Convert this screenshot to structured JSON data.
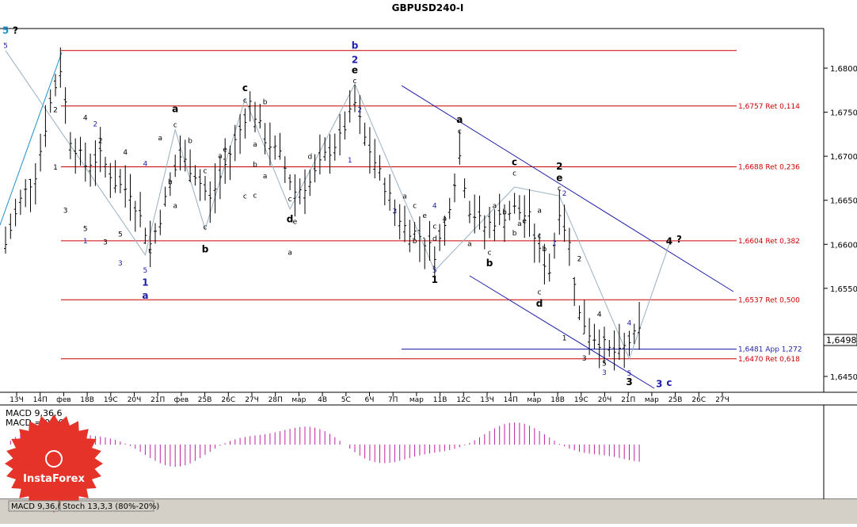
{
  "chart_data": {
    "type": "ohlc",
    "title": "GBPUSD240-I",
    "price_tag": "1,6498",
    "y_ticks": [
      "1,6800",
      "1,6750",
      "1,6700",
      "1,6650",
      "1,6600",
      "1,6550",
      "1,6450"
    ],
    "ylim": [
      1.6432,
      1.6845
    ],
    "x_ticks": [
      "13Ч",
      "14П",
      "фев",
      "18В",
      "19С",
      "20Ч",
      "21П",
      "фев",
      "25В",
      "26С",
      "27Ч",
      "28П",
      "мар",
      "4В",
      "5С",
      "6Ч",
      "7П",
      "мар",
      "11В",
      "12С",
      "13Ч",
      "14П",
      "мар",
      "18В",
      "19С",
      "20Ч",
      "21П",
      "мар",
      "25В",
      "26С",
      "27Ч"
    ],
    "levels": [
      {
        "price": 1.682,
        "label": ""
      },
      {
        "price": 1.6757,
        "label": "1,6757 Ret 0,114"
      },
      {
        "price": 1.6688,
        "label": "1,6688 Ret 0,236"
      },
      {
        "price": 1.6604,
        "label": "1,6604 Ret 0,382"
      },
      {
        "price": 1.6537,
        "label": "1,6537 Ret 0,500"
      },
      {
        "price": 1.6481,
        "label": "1,6481 App 1,272"
      },
      {
        "price": 1.647,
        "label": "1,6470 Ret 0,618"
      }
    ],
    "wave_labels": [
      {
        "t": "5",
        "bar": 0,
        "p": 1.6839,
        "c": "teal",
        "big": true
      },
      {
        "t": "?",
        "bar": 2,
        "p": 1.6839,
        "c": "black",
        "big": true
      },
      {
        "t": "5",
        "bar": 0,
        "p": 1.6823,
        "c": "blue"
      },
      {
        "t": "b",
        "bar": 70,
        "p": 1.6822,
        "c": "blue",
        "big": true
      },
      {
        "t": "2",
        "bar": 70,
        "p": 1.6806,
        "c": "blue",
        "big": true
      },
      {
        "t": "e",
        "bar": 70,
        "p": 1.6794,
        "c": "black",
        "big": true
      },
      {
        "t": "c",
        "bar": 70,
        "p": 1.6783,
        "c": "black"
      },
      {
        "t": "2",
        "bar": 71,
        "p": 1.675,
        "c": "blue"
      },
      {
        "t": "1",
        "bar": 69,
        "p": 1.6693,
        "c": "blue"
      },
      {
        "t": "c",
        "bar": 48,
        "p": 1.6774,
        "c": "black",
        "big": true
      },
      {
        "t": "c",
        "bar": 48,
        "p": 1.6761,
        "c": "black"
      },
      {
        "t": "b",
        "bar": 52,
        "p": 1.6759,
        "c": "black"
      },
      {
        "t": "a",
        "bar": 34,
        "p": 1.675,
        "c": "black",
        "big": true
      },
      {
        "t": "c",
        "bar": 34,
        "p": 1.6733,
        "c": "black"
      },
      {
        "t": "2",
        "bar": 18,
        "p": 1.6734,
        "c": "blue"
      },
      {
        "t": "4",
        "bar": 16,
        "p": 1.6741,
        "c": "black"
      },
      {
        "t": "2",
        "bar": 10,
        "p": 1.675,
        "c": "black"
      },
      {
        "t": "2",
        "bar": 19,
        "p": 1.6715,
        "c": "black"
      },
      {
        "t": "4",
        "bar": 24,
        "p": 1.6702,
        "c": "black"
      },
      {
        "t": "4",
        "bar": 28,
        "p": 1.6689,
        "c": "blue"
      },
      {
        "t": "1",
        "bar": 10,
        "p": 1.6685,
        "c": "black"
      },
      {
        "t": "3",
        "bar": 12,
        "p": 1.6636,
        "c": "black"
      },
      {
        "t": "5",
        "bar": 16,
        "p": 1.6615,
        "c": "black"
      },
      {
        "t": "1",
        "bar": 16,
        "p": 1.6601,
        "c": "blue"
      },
      {
        "t": "3",
        "bar": 20,
        "p": 1.66,
        "c": "black"
      },
      {
        "t": "5",
        "bar": 23,
        "p": 1.6609,
        "c": "black"
      },
      {
        "t": "3",
        "bar": 23,
        "p": 1.6576,
        "c": "blue"
      },
      {
        "t": "a",
        "bar": 31,
        "p": 1.6718,
        "c": "black"
      },
      {
        "t": "b",
        "bar": 37,
        "p": 1.6715,
        "c": "black"
      },
      {
        "t": "b",
        "bar": 33,
        "p": 1.6668,
        "c": "black"
      },
      {
        "t": "c",
        "bar": 40,
        "p": 1.6681,
        "c": "black"
      },
      {
        "t": "a",
        "bar": 43,
        "p": 1.6698,
        "c": "black"
      },
      {
        "t": "c",
        "bar": 48,
        "p": 1.6652,
        "c": "black"
      },
      {
        "t": "a",
        "bar": 34,
        "p": 1.6641,
        "c": "black"
      },
      {
        "t": "c",
        "bar": 40,
        "p": 1.6617,
        "c": "black"
      },
      {
        "t": "b",
        "bar": 40,
        "p": 1.6591,
        "c": "black",
        "big": true
      },
      {
        "t": "e",
        "bar": 44,
        "p": 1.6705,
        "c": "black"
      },
      {
        "t": "a",
        "bar": 50,
        "p": 1.6711,
        "c": "black"
      },
      {
        "t": "c",
        "bar": 50,
        "p": 1.6653,
        "c": "black"
      },
      {
        "t": "b",
        "bar": 50,
        "p": 1.6688,
        "c": "black"
      },
      {
        "t": "a",
        "bar": 52,
        "p": 1.6675,
        "c": "black"
      },
      {
        "t": "e",
        "bar": 58,
        "p": 1.6623,
        "c": "black"
      },
      {
        "t": "c",
        "bar": 57,
        "p": 1.6649,
        "c": "black"
      },
      {
        "t": "d",
        "bar": 57,
        "p": 1.6625,
        "c": "black",
        "big": true
      },
      {
        "t": "d",
        "bar": 61,
        "p": 1.6697,
        "c": "black"
      },
      {
        "t": "a",
        "bar": 57,
        "p": 1.6588,
        "c": "black"
      },
      {
        "t": "c",
        "bar": 29,
        "p": 1.659,
        "c": "black"
      },
      {
        "t": "5",
        "bar": 28,
        "p": 1.6568,
        "c": "blue"
      },
      {
        "t": "1",
        "bar": 28,
        "p": 1.6553,
        "c": "blue",
        "big": true
      },
      {
        "t": "a",
        "bar": 28,
        "p": 1.6538,
        "c": "blue",
        "big": true
      },
      {
        "t": "3",
        "bar": 78,
        "p": 1.6635,
        "c": "blue"
      },
      {
        "t": "a",
        "bar": 80,
        "p": 1.6652,
        "c": "black"
      },
      {
        "t": "c",
        "bar": 82,
        "p": 1.6641,
        "c": "black"
      },
      {
        "t": "e",
        "bar": 84,
        "p": 1.663,
        "c": "black"
      },
      {
        "t": "4",
        "bar": 86,
        "p": 1.6641,
        "c": "blue"
      },
      {
        "t": "c",
        "bar": 86,
        "p": 1.6618,
        "c": "black"
      },
      {
        "t": "d",
        "bar": 86,
        "p": 1.6604,
        "c": "black"
      },
      {
        "t": "a",
        "bar": 88,
        "p": 1.6627,
        "c": "black"
      },
      {
        "t": "b",
        "bar": 82,
        "p": 1.6601,
        "c": "black"
      },
      {
        "t": "5",
        "bar": 86,
        "p": 1.6568,
        "c": "blue"
      },
      {
        "t": "1",
        "bar": 86,
        "p": 1.6556,
        "c": "black",
        "big": true
      },
      {
        "t": "a",
        "bar": 91,
        "p": 1.6738,
        "c": "black",
        "big": true
      },
      {
        "t": "c",
        "bar": 91,
        "p": 1.6726,
        "c": "black"
      },
      {
        "t": "a",
        "bar": 93,
        "p": 1.6598,
        "c": "black"
      },
      {
        "t": "c",
        "bar": 97,
        "p": 1.6588,
        "c": "black"
      },
      {
        "t": "b",
        "bar": 97,
        "p": 1.6575,
        "c": "black",
        "big": true
      },
      {
        "t": "c",
        "bar": 102,
        "p": 1.669,
        "c": "black",
        "big": true
      },
      {
        "t": "c",
        "bar": 102,
        "p": 1.6678,
        "c": "black"
      },
      {
        "t": "a",
        "bar": 98,
        "p": 1.6641,
        "c": "black"
      },
      {
        "t": "b",
        "bar": 100,
        "p": 1.6634,
        "c": "black"
      },
      {
        "t": "a",
        "bar": 103,
        "p": 1.6621,
        "c": "black"
      },
      {
        "t": "b",
        "bar": 102,
        "p": 1.661,
        "c": "black"
      },
      {
        "t": "e",
        "bar": 104,
        "p": 1.6624,
        "c": "black"
      },
      {
        "t": "c",
        "bar": 107,
        "p": 1.6607,
        "c": "black"
      },
      {
        "t": "a",
        "bar": 107,
        "p": 1.6636,
        "c": "black"
      },
      {
        "t": "b",
        "bar": 108,
        "p": 1.6592,
        "c": "black"
      },
      {
        "t": "c",
        "bar": 107,
        "p": 1.6543,
        "c": "black"
      },
      {
        "t": "d",
        "bar": 107,
        "p": 1.6529,
        "c": "black",
        "big": true
      },
      {
        "t": "2",
        "bar": 111,
        "p": 1.6685,
        "c": "black",
        "big": true
      },
      {
        "t": "e",
        "bar": 111,
        "p": 1.6672,
        "c": "black",
        "big": true
      },
      {
        "t": "c",
        "bar": 111,
        "p": 1.6661,
        "c": "black"
      },
      {
        "t": "2",
        "bar": 112,
        "p": 1.6655,
        "c": "blue"
      },
      {
        "t": "1",
        "bar": 110,
        "p": 1.6599,
        "c": "blue"
      },
      {
        "t": "2",
        "bar": 115,
        "p": 1.6581,
        "c": "black"
      },
      {
        "t": "4",
        "bar": 119,
        "p": 1.6518,
        "c": "black"
      },
      {
        "t": "1",
        "bar": 112,
        "p": 1.6491,
        "c": "black"
      },
      {
        "t": "3",
        "bar": 116,
        "p": 1.6468,
        "c": "black"
      },
      {
        "t": "5",
        "bar": 120,
        "p": 1.6462,
        "c": "black"
      },
      {
        "t": "3",
        "bar": 120,
        "p": 1.6452,
        "c": "blue"
      },
      {
        "t": "4",
        "bar": 125,
        "p": 1.6508,
        "c": "blue"
      },
      {
        "t": "5",
        "bar": 125,
        "p": 1.6451,
        "c": "blue"
      },
      {
        "t": "3",
        "bar": 125,
        "p": 1.644,
        "c": "black",
        "big": true
      },
      {
        "t": "3",
        "bar": 131,
        "p": 1.6438,
        "c": "blue",
        "big": true
      },
      {
        "t": "c",
        "bar": 133,
        "p": 1.6439,
        "c": "blue",
        "big": true
      },
      {
        "t": "4",
        "bar": 133,
        "p": 1.66,
        "c": "black",
        "big": true
      },
      {
        "t": "?",
        "bar": 135,
        "p": 1.6602,
        "c": "black",
        "big": true
      }
    ],
    "macd_label": "MACD 9,36,6",
    "macd_value_label": "MACD = 0,00",
    "tabs": [
      "MACD 9,36,6",
      "Stoch 13,3,3 (80%-20%)"
    ],
    "logo_text": "InstaForex"
  }
}
